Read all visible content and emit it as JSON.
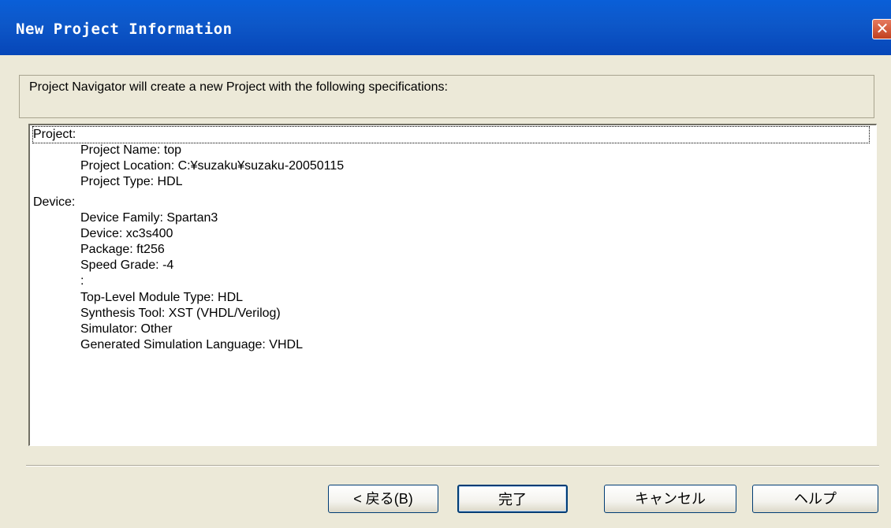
{
  "window": {
    "title": "New Project Information",
    "close_icon": "close-icon",
    "close_glyph": "✕"
  },
  "info": {
    "text": "Project Navigator will create a new Project with the following specifications:"
  },
  "spec_lines": [
    "Project:",
    "Project Name: top",
    "Project Location: C:¥suzaku¥suzaku-20050115",
    "Project Type: HDL",
    "Device:",
    "Device Family: Spartan3",
    "Device: xc3s400",
    "Package: ft256",
    "Speed Grade: -4",
    ":",
    "Top-Level Module Type: HDL",
    "Synthesis Tool: XST (VHDL/Verilog)",
    "Simulator: Other",
    "Generated Simulation Language: VHDL"
  ],
  "buttons": {
    "back": "< 戻る(B)",
    "finish": "完了",
    "cancel": "キャンセル",
    "help": "ヘルプ"
  },
  "colors": {
    "titlebar": "#0a5fd8",
    "dialog_bg": "#ece9d8",
    "close_button": "#c1401f"
  }
}
